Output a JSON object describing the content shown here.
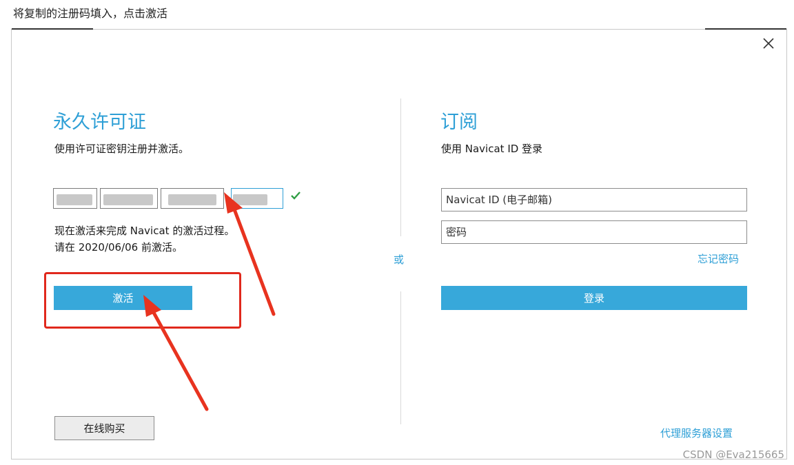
{
  "caption": "将复制的注册码填入，点击激活",
  "dialog": {
    "left": {
      "title": "永久许可证",
      "subtitle": "使用许可证密钥注册并激活。",
      "info_line1": "现在激活来完成 Navicat 的激活过程。",
      "info_line2": "请在 2020/06/06 前激活。",
      "activate_label": "激活",
      "buy_label": "在线购买"
    },
    "or_label": "或",
    "right": {
      "title": "订阅",
      "subtitle": "使用 Navicat ID 登录",
      "id_placeholder": "Navicat ID (电子邮箱)",
      "password_placeholder": "密码",
      "forgot_label": "忘记密码",
      "login_label": "登录",
      "proxy_label": "代理服务器设置"
    }
  },
  "watermark": "CSDN @Eva215665",
  "colors": {
    "accent": "#37a8da",
    "highlight": "#e0281c",
    "check": "#2f9e44"
  }
}
